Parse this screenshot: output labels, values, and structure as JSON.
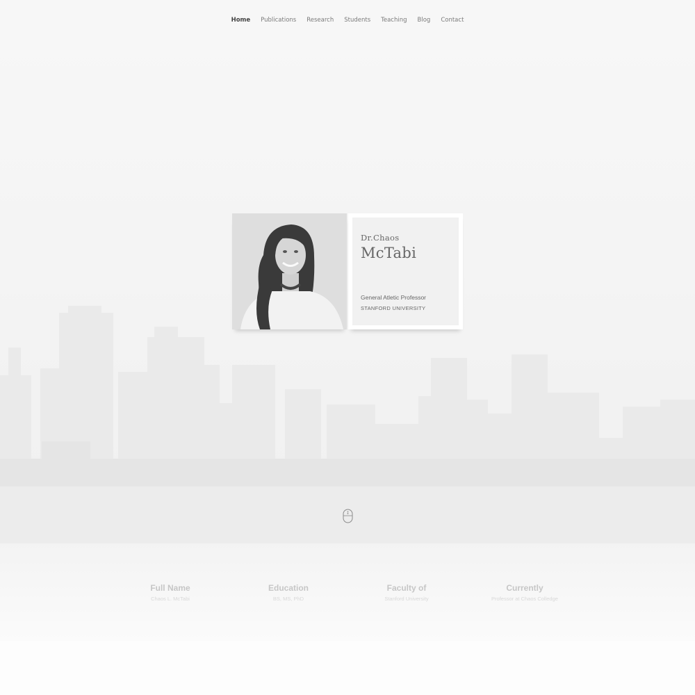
{
  "nav": {
    "items": [
      {
        "label": "Home",
        "active": true
      },
      {
        "label": "Publications"
      },
      {
        "label": "Research"
      },
      {
        "label": "Students"
      },
      {
        "label": "Teaching"
      },
      {
        "label": "Blog"
      },
      {
        "label": "Contact"
      }
    ]
  },
  "profile": {
    "pre_name": "Dr.Chaos",
    "last_name": "McTabi",
    "role": "General Atletic Professor",
    "university": "STANFORD UNIVERSITY"
  },
  "facts": [
    {
      "title": "Full Name",
      "value": "Chaos L. McTabi"
    },
    {
      "title": "Education",
      "value": "BS, MS, PhD"
    },
    {
      "title": "Faculty of",
      "value": "Stanford University"
    },
    {
      "title": "Currently",
      "value": "Professor at Chaos Colledge"
    }
  ],
  "icons": {
    "scroll": "mouse-scroll-icon"
  },
  "colors": {
    "background": "#f6f6f6",
    "card": "#ffffff",
    "text": "#666666"
  }
}
